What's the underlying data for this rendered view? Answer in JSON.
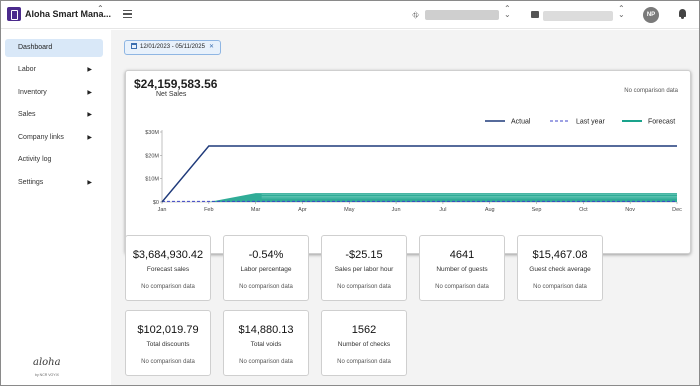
{
  "app": {
    "title": "Aloha Smart Mana...",
    "avatar_initials": "NP"
  },
  "sidebar": {
    "items": [
      {
        "label": "Dashboard",
        "active": true,
        "has_submenu": false
      },
      {
        "label": "Labor",
        "active": false,
        "has_submenu": true
      },
      {
        "label": "Inventory",
        "active": false,
        "has_submenu": true
      },
      {
        "label": "Sales",
        "active": false,
        "has_submenu": true
      },
      {
        "label": "Company links",
        "active": false,
        "has_submenu": true
      },
      {
        "label": "Activity log",
        "active": false,
        "has_submenu": false
      },
      {
        "label": "Settings",
        "active": false,
        "has_submenu": true
      }
    ],
    "brand": "aloha",
    "brand_sub": "by NCR VOYIX"
  },
  "filters": {
    "date_range": "12/01/2023 - 05/11/2025"
  },
  "net_sales": {
    "value": "$24,159,583.56",
    "label": "Net Sales",
    "comparison": "No comparison data"
  },
  "chart_data": {
    "type": "line",
    "x": [
      "Jan",
      "Feb",
      "Mar",
      "Apr",
      "May",
      "Jun",
      "Jul",
      "Aug",
      "Sep",
      "Oct",
      "Nov",
      "Dec"
    ],
    "y_ticks": [
      "$0",
      "$10M",
      "$20M",
      "$30M"
    ],
    "ylim": [
      0,
      30000000
    ],
    "series": [
      {
        "name": "Actual",
        "style": "solid",
        "color": "#1f3a7a",
        "values": [
          0,
          24000000,
          24000000,
          24000000,
          24000000,
          24000000,
          24000000,
          24000000,
          24000000,
          24000000,
          24000000,
          24000000
        ]
      },
      {
        "name": "Last year",
        "style": "dashed",
        "color": "#3d44c8",
        "values": [
          0,
          0,
          0,
          0,
          0,
          0,
          0,
          0,
          0,
          0,
          0,
          0
        ]
      },
      {
        "name": "Forecast",
        "style": "area",
        "color": "#1aa38c",
        "values": [
          0,
          0,
          3800000,
          3800000,
          3800000,
          3800000,
          3800000,
          3800000,
          3800000,
          3800000,
          3800000,
          3800000
        ]
      }
    ]
  },
  "metrics": [
    {
      "value": "$3,684,930.42",
      "label": "Forecast sales",
      "comparison": "No comparison data"
    },
    {
      "value": "-0.54%",
      "label": "Labor percentage",
      "comparison": "No comparison data"
    },
    {
      "value": "-$25.15",
      "label": "Sales per labor hour",
      "comparison": "No comparison data"
    },
    {
      "value": "4641",
      "label": "Number of guests",
      "comparison": "No comparison data"
    },
    {
      "value": "$15,467.08",
      "label": "Guest check average",
      "comparison": "No comparison data"
    },
    {
      "value": "$102,019.79",
      "label": "Total discounts",
      "comparison": "No comparison data"
    },
    {
      "value": "$14,880.13",
      "label": "Total voids",
      "comparison": "No comparison data"
    },
    {
      "value": "1562",
      "label": "Number of checks",
      "comparison": "No comparison data"
    }
  ]
}
